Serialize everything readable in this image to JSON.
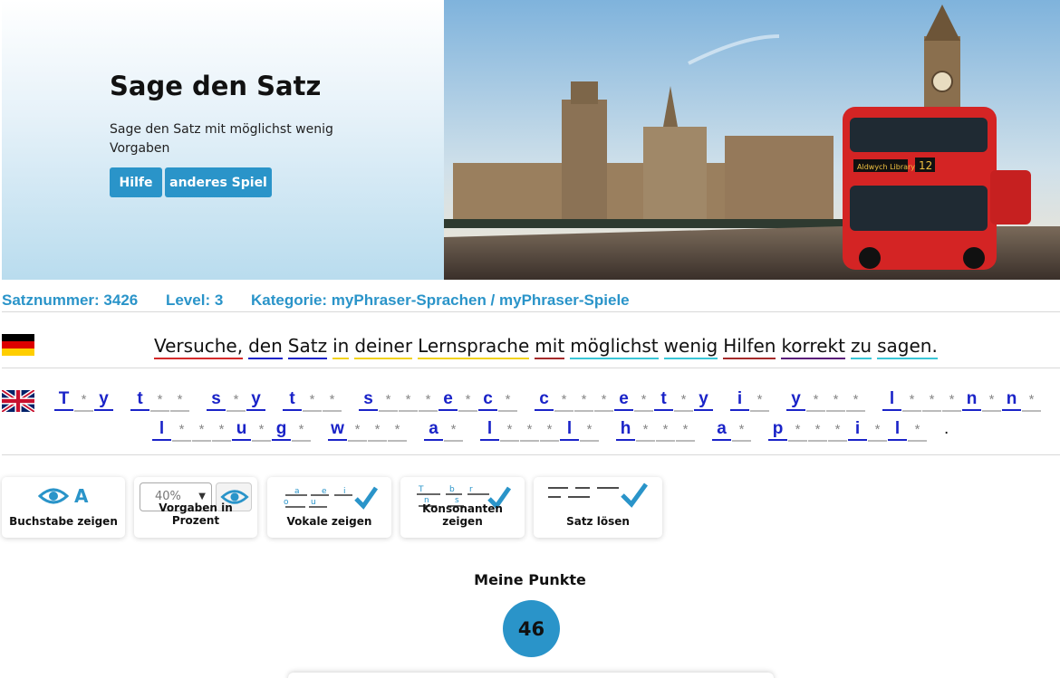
{
  "hero": {
    "title": "Sage den Satz",
    "subtitle": "Sage den Satz mit möglichst wenig Vorgaben",
    "help_label": "Hilfe",
    "other_game_label": "anderes Spiel",
    "bus_sign": "Aldwych Library",
    "bus_number": "12"
  },
  "info": {
    "sentence_number": "Satznummer: 3426",
    "level": "Level: 3",
    "category": "Kategorie: myPhraser-Sprachen / myPhraser-Spiele"
  },
  "german_sentence": {
    "words": [
      {
        "text": "Versuche,",
        "color": "#d42a2a"
      },
      {
        "text": "den",
        "color": "#1a23c8"
      },
      {
        "text": "Satz",
        "color": "#1a23c8"
      },
      {
        "text": "in",
        "color": "#f2d21c"
      },
      {
        "text": "deiner",
        "color": "#f2d21c"
      },
      {
        "text": "Lernsprache",
        "color": "#f2d21c"
      },
      {
        "text": "mit",
        "color": "#a52a2a"
      },
      {
        "text": "möglichst",
        "color": "#39c6d6"
      },
      {
        "text": "wenig",
        "color": "#39c6d6"
      },
      {
        "text": "Hilfen",
        "color": "#a52a2a"
      },
      {
        "text": "korrekt",
        "color": "#5a1a7a"
      },
      {
        "text": "zu",
        "color": "#39c6d6"
      },
      {
        "text": "sagen.",
        "color": "#39c6d6"
      }
    ]
  },
  "masked_sentence": {
    "line1": [
      "T*y",
      "t**",
      "s*y",
      "t**",
      "s***e*c*",
      "c***e*t*y",
      "i*",
      "y***",
      "l***n*n*"
    ],
    "line2": [
      "l***u*g*",
      "w***",
      "a*",
      "l***l*",
      "h***",
      "a*",
      "p***i*l*"
    ],
    "end": "."
  },
  "tools": {
    "show_letter": "Buchstabe zeigen",
    "show_letter_glyph": "A",
    "percent_value": "40%",
    "percent_label": "Vorgaben in Prozent",
    "show_vowels": "Vokale zeigen",
    "show_consonants": "Konsonanten zeigen",
    "solve": "Satz lösen"
  },
  "score": {
    "title": "Meine Punkte",
    "value": "46"
  },
  "colors": {
    "accent": "#2a94c9",
    "revealed_letter": "#1a23c8"
  }
}
